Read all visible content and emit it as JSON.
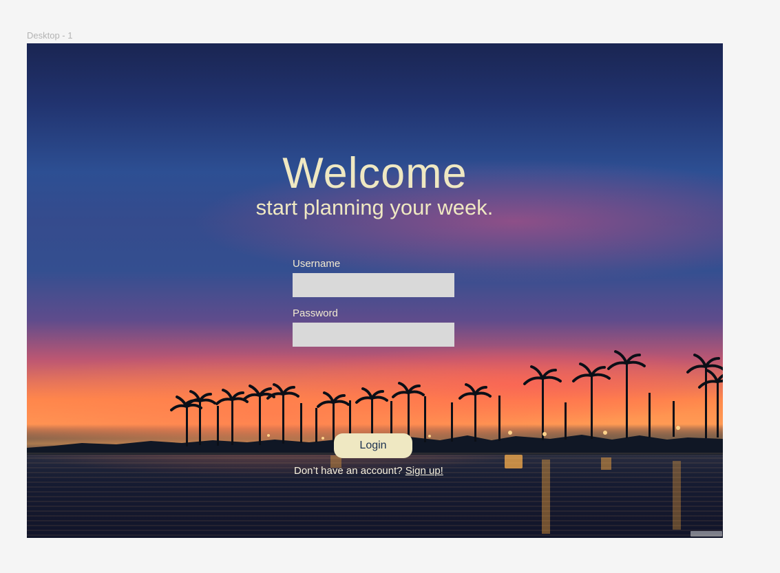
{
  "canvas": {
    "frame_title": "Desktop - 1"
  },
  "hero": {
    "title": "Welcome",
    "subtitle": "start planning your week."
  },
  "form": {
    "username_label": "Username",
    "username_value": "",
    "password_label": "Password",
    "password_value": "",
    "login_label": "Login",
    "signup_prompt": "Don’t have an account?",
    "signup_link": "Sign up!"
  },
  "colors": {
    "text_cream": "#efe8c2",
    "input_background": "#d9d9d9",
    "button_background": "#efe8c2",
    "button_text": "#1b3150"
  }
}
